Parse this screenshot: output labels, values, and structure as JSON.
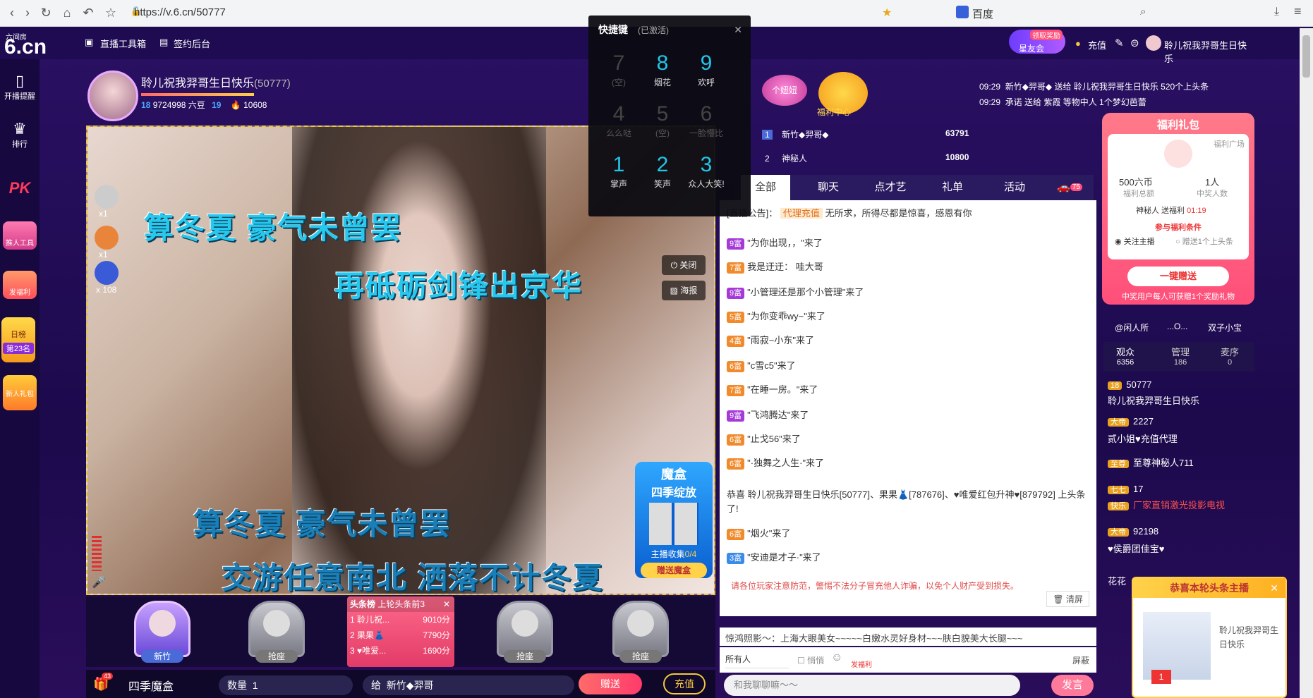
{
  "browser": {
    "url": "https://v.6.cn/50777",
    "search_engine": "百度"
  },
  "site": {
    "logo_top": "六间房",
    "logo_main": "6.cn",
    "tools_label": "直播工具箱",
    "sign_label": "签约后台"
  },
  "left_nav": [
    {
      "label": "开播提醒"
    },
    {
      "label": "排行"
    },
    {
      "label": "PK"
    },
    {
      "label": "推人工具"
    },
    {
      "label": "发福利"
    },
    {
      "label": "日榜"
    },
    {
      "label": "第23名"
    },
    {
      "label": "新人礼包"
    }
  ],
  "anchor": {
    "name": "聆儿祝我羿哥生日快乐",
    "room_id": "(50777)",
    "level": "18",
    "beans": "9724998 六豆",
    "level2": "19",
    "fans": "10608"
  },
  "video": {
    "lyrics": [
      "算冬夏  豪气未曾罢",
      "再砥砺剑锋出京华",
      "算冬夏  豪气未曾罢",
      "交游任意南北  洒落不计冬夏"
    ],
    "close_label": "关闭",
    "poster_label": "海报",
    "badges": [
      "x1",
      "x1",
      "x 108"
    ],
    "mohe_title": "魔盒",
    "mohe_sub": "四季绽放",
    "mohe_collect": "主播收集",
    "mohe_count": "0/4",
    "mohe_btn": "赠送魔盒"
  },
  "seats": [
    {
      "label": "新竹"
    },
    {
      "label": "抢座"
    },
    {
      "label": "抢座"
    },
    {
      "label": "抢座"
    }
  ],
  "top_list": {
    "title": "头条榜",
    "subtitle": "上轮头条前3",
    "rows": [
      {
        "rank": "1",
        "name": "聆儿祝...",
        "score": "9010分"
      },
      {
        "rank": "2",
        "name": "果果👗",
        "score": "7790分"
      },
      {
        "rank": "3",
        "name": "♥唯爱...",
        "score": "1690分"
      }
    ]
  },
  "bottom_bar": {
    "gift_count": "43",
    "gift_name": "四季魔盒",
    "qty_label": "数量",
    "qty_value": "1",
    "to_label": "给",
    "to_value": "新竹◆羿哥",
    "send_label": "赠送",
    "recharge_label": "充值"
  },
  "hotkey": {
    "title": "快捷键",
    "status": "(已激活)",
    "keys": [
      {
        "n": "7",
        "t": "(空)",
        "dim": true
      },
      {
        "n": "8",
        "t": "烟花",
        "dim": false
      },
      {
        "n": "9",
        "t": "欢呼",
        "dim": false
      },
      {
        "n": "4",
        "t": "么么哒",
        "dim": true
      },
      {
        "n": "5",
        "t": "(空)",
        "dim": true
      },
      {
        "n": "6",
        "t": "一脸懵比",
        "dim": true
      },
      {
        "n": "1",
        "t": "掌声",
        "dim": false
      },
      {
        "n": "2",
        "t": "笑声",
        "dim": false
      },
      {
        "n": "3",
        "t": "众人大笑!",
        "dim": false
      }
    ]
  },
  "rank": {
    "personal_girl": "个妞妞",
    "welfare_center": "福利中心",
    "notices": [
      {
        "time": "09:29",
        "text": "新竹◆羿哥◆ 送给 聆儿祝我羿哥生日快乐 520个上头条"
      },
      {
        "time": "09:29",
        "text": "承诺 送给 紫霞 等物中人 1个梦幻芭蕾"
      }
    ],
    "rows": [
      {
        "rank": "1",
        "name": "新竹◆羿哥◆",
        "score": "63791"
      },
      {
        "rank": "2",
        "name": "神秘人",
        "score": "10800"
      }
    ]
  },
  "chat_tabs": [
    {
      "label": "全部"
    },
    {
      "label": "聊天"
    },
    {
      "label": "点才艺"
    },
    {
      "label": "礼单"
    },
    {
      "label": "活动"
    },
    {
      "label": "75"
    }
  ],
  "chat": {
    "announce_prefix": "[直播公告]：",
    "announce_tag": "代理充值",
    "announce_text": "无所求，所得尽都是惊喜，感恩有你",
    "messages": [
      {
        "lvl": "9富",
        "text": "\"为你出现，，\"来了"
      },
      {
        "lvl": "7富",
        "text": "我是迂迂：  哇大哥"
      },
      {
        "lvl": "9富",
        "text": "\"小管理还是那个小管理\"来了"
      },
      {
        "lvl": "5富",
        "text": "\"为你变乖wy~\"来了"
      },
      {
        "lvl": "4富",
        "text": "\"雨寂~小东\"来了"
      },
      {
        "lvl": "6富",
        "text": "\"c雪c5\"来了"
      },
      {
        "lvl": "7富",
        "text": "\"在睡一房。\"来了"
      },
      {
        "lvl": "9富",
        "text": "\"飞鸿腾达\"来了"
      },
      {
        "lvl": "6富",
        "text": "\"止戈56\"来了"
      },
      {
        "lvl": "6富",
        "text": "\"·独舞之人生·\"来了"
      }
    ],
    "congrats": "恭喜 聆儿祝我羿哥生日快乐[50777]、果果👗[787676]、♥唯爱红包升神♥[879792] 上头条了!",
    "after": [
      {
        "lvl": "6富",
        "text": "\"烟火\"来了"
      },
      {
        "lvl": "3富",
        "text": "\"安迪是才子·\"来了"
      }
    ],
    "warning": "请各位玩家注意防范，警惕不法分子冒充他人诈骗，以免个人财产受到损失。",
    "clear_label": "清屏",
    "marquee": "惊鸿照影～：上海大眼美女~~~~~白嫩水灵好身材~~~肤白貌美大长腿~~~",
    "target": "所有人",
    "whisper": "悄悄",
    "fuli": "发福利",
    "shield": "屏蔽",
    "input_placeholder": "和我聊聊嘛～～",
    "send_label": "发言"
  },
  "benefit": {
    "title": "福利礼包",
    "square": "福利广场",
    "total_label": "福利总额",
    "total_value": "500六币",
    "winners_label": "中奖人数",
    "winners_value": "1人",
    "giver": "神秘人 送福利",
    "timer": "01:19",
    "cond_title": "参与福利条件",
    "cond1": "关注主播",
    "cond2": "赠送1个上头条",
    "btn": "一键赠送",
    "note": "中奖用户每人可获赠1个奖励礼物"
  },
  "fans_row": [
    "@闲人所",
    "...O...",
    "双子小宝"
  ],
  "audience_tabs": [
    {
      "label": "观众",
      "count": "6356"
    },
    {
      "label": "管理",
      "count": "186"
    },
    {
      "label": "麦序",
      "count": "0"
    }
  ],
  "audience": [
    {
      "tag": "18",
      "name": "50777"
    },
    {
      "tag": "",
      "name": "聆儿祝我羿哥生日快乐"
    },
    {
      "tag": "大帝",
      "name": "2227"
    },
    {
      "tag": "",
      "name": "贰小姐♥充值代理"
    },
    {
      "tag": "至尊",
      "name": "至尊神秘人711"
    },
    {
      "tag": "七七",
      "name": "17"
    },
    {
      "tag": "快乐",
      "name": "厂家直销激光投影电视"
    },
    {
      "tag": "大帝",
      "name": "92198"
    },
    {
      "tag": "",
      "name": "♥侯爵团佳宝♥"
    },
    {
      "tag": "",
      "name": "花花"
    }
  ],
  "popup": {
    "title": "恭喜本轮头条主播",
    "name": "聆儿祝我羿哥生日快乐",
    "badge": "1"
  },
  "top_right": {
    "reward": "领取奖励",
    "club": "星友会",
    "recharge": "充值",
    "user": "聆儿祝我羿哥生日快乐"
  },
  "colors": {
    "bg": "#1c0a4c",
    "accent": "#ff4f7a",
    "lyric": "#27c8ee",
    "gold": "#f5c542"
  }
}
